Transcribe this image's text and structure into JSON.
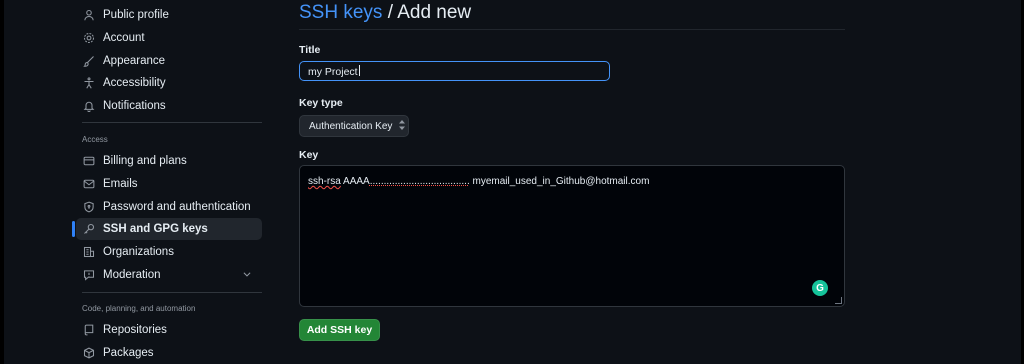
{
  "sidebar": {
    "items_top": [
      {
        "label": "Public profile",
        "icon": "person-icon"
      },
      {
        "label": "Account",
        "icon": "gear-icon"
      },
      {
        "label": "Appearance",
        "icon": "paintbrush-icon"
      },
      {
        "label": "Accessibility",
        "icon": "accessibility-icon"
      },
      {
        "label": "Notifications",
        "icon": "bell-icon"
      }
    ],
    "access_heading": "Access",
    "access_items": [
      {
        "label": "Billing and plans",
        "icon": "credit-card-icon"
      },
      {
        "label": "Emails",
        "icon": "mail-icon"
      },
      {
        "label": "Password and authentication",
        "icon": "shield-lock-icon"
      },
      {
        "label": "SSH and GPG keys",
        "icon": "key-icon",
        "active": true
      },
      {
        "label": "Organizations",
        "icon": "organization-icon"
      },
      {
        "label": "Moderation",
        "icon": "report-icon"
      }
    ],
    "code_heading": "Code, planning, and automation",
    "code_items": [
      {
        "label": "Repositories",
        "icon": "repo-icon"
      },
      {
        "label": "Packages",
        "icon": "package-icon"
      }
    ]
  },
  "main": {
    "heading_link": "SSH keys",
    "heading_rest": " / Add new",
    "title_label": "Title",
    "title_value": "my Project",
    "key_type_label": "Key type",
    "key_type_value": "Authentication Key",
    "key_label": "Key",
    "key_prefix": "ssh-rsa",
    "key_mid": " AAAA",
    "key_dots": "....................................",
    "key_suffix": " myemail_used_in_Github@hotmail.com",
    "submit_label": "Add SSH key"
  },
  "colors": {
    "accent": "#4493f8",
    "button": "#238636",
    "background": "#0d1117"
  }
}
